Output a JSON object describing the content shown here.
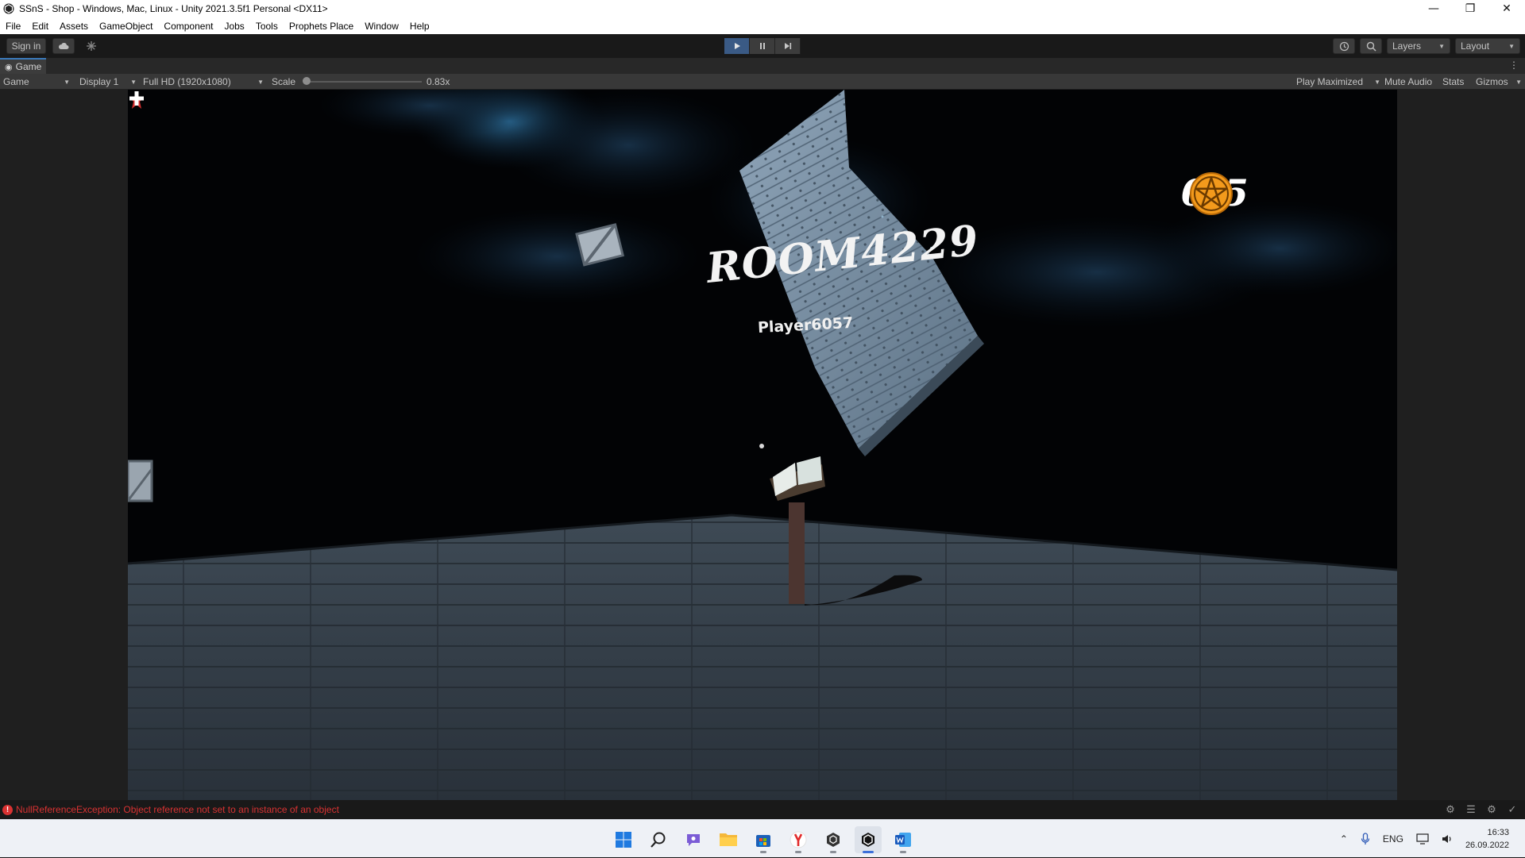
{
  "window": {
    "title": "SSnS - Shop - Windows, Mac, Linux - Unity 2021.3.5f1 Personal <DX11>",
    "controls": [
      "minimize",
      "restore",
      "close"
    ]
  },
  "menu": [
    "File",
    "Edit",
    "Assets",
    "GameObject",
    "Component",
    "Jobs",
    "Tools",
    "Prophets Place",
    "Window",
    "Help"
  ],
  "toolbar": {
    "sign_in": "Sign in",
    "play_state": "playing",
    "layers": "Layers",
    "layout": "Layout"
  },
  "game_tab": {
    "label": "Game"
  },
  "game_toolbar": {
    "view": "Game",
    "display": "Display 1",
    "resolution": "Full HD (1920x1080)",
    "scale_label": "Scale",
    "scale_value": "0.83x",
    "scale_fraction": 0.0,
    "play_maximized": "Play Maximized",
    "mute_audio": "Mute Audio",
    "stats": "Stats",
    "gizmos": "Gizmos"
  },
  "hud": {
    "counter": "0/5",
    "room": "ROOM4229",
    "player": "Player6057"
  },
  "status": {
    "error": "NullReferenceException: Object reference not set to an instance of an object"
  },
  "taskbar": {
    "apps": [
      "start-icon",
      "search-icon",
      "chat-icon",
      "file-explorer-icon",
      "store-icon",
      "yandex-browser-icon",
      "unity-hub-icon",
      "unity-editor-icon",
      "word-icon"
    ],
    "language": "ENG",
    "time": "16:33",
    "date": "26.09.2022"
  },
  "colors": {
    "accent": "#3a79bb",
    "error": "#d93232",
    "pentacle": "#f39a1c"
  }
}
